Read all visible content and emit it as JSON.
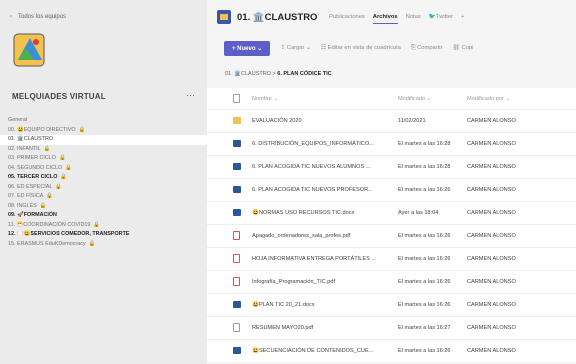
{
  "sidebar": {
    "back_label": "Todos los equipos",
    "team_name": "MELQUIADES VIRTUAL",
    "more": "···",
    "channels": [
      {
        "label": "General",
        "bold": false,
        "selected": false
      },
      {
        "label": "00. 😃EQUIPO DIRECTIVO",
        "bold": false,
        "selected": false,
        "pin": "🔒"
      },
      {
        "label": "01. 🏛️CLAUSTRO",
        "bold": false,
        "selected": true
      },
      {
        "label": "02. INFANTIL",
        "bold": false,
        "selected": false,
        "pin": "🔒"
      },
      {
        "label": "03. PRIMER CICLO",
        "bold": false,
        "selected": false,
        "pin": "🔒"
      },
      {
        "label": "04. SEGUNDO CICLO",
        "bold": false,
        "selected": false,
        "pin": "🔒"
      },
      {
        "label": "05. TERCER CICLO",
        "bold": true,
        "selected": false,
        "pin": "🔒"
      },
      {
        "label": "06. ED ESPECIAL",
        "bold": false,
        "selected": false,
        "pin": "🔒"
      },
      {
        "label": "07. ED FÍSICA",
        "bold": false,
        "selected": false,
        "pin": "🔒"
      },
      {
        "label": "08. INGLÉS",
        "bold": false,
        "selected": false,
        "pin": "🔒"
      },
      {
        "label": "09. 🚀FORMACIÓN",
        "bold": true,
        "selected": false
      },
      {
        "label": "11. 😷COORDINACIÓN COVID19",
        "bold": false,
        "selected": false,
        "pin": "🔒"
      },
      {
        "label": "12. 🍽️😃SERVICIOS COMEDOR, TRANSPORTE",
        "bold": true,
        "selected": false
      },
      {
        "label": "15. ERASMUS EduKDemocracy",
        "bold": false,
        "selected": false,
        "pin": "🔒"
      }
    ]
  },
  "header": {
    "title": "01. 🏛️CLAUSTRO",
    "tabs": [
      {
        "label": "Publicaciones",
        "active": false
      },
      {
        "label": "Archivos",
        "active": true
      },
      {
        "label": "Notas",
        "active": false
      },
      {
        "label": "🐦Twitter",
        "active": false
      },
      {
        "label": "+",
        "active": false
      }
    ]
  },
  "toolbar": {
    "new_label": "+ Nuevo ⌄",
    "items": [
      "⇪ Cargar ⌄",
      "☷ Editar en vista de cuadrícula",
      "⎘ Compartir",
      "⛓ Copi"
    ]
  },
  "breadcrumb": {
    "parent": "01. 🏛️CLAUSTRO",
    "sep": ">",
    "current": "6. PLAN CÓDICE TIC"
  },
  "list": {
    "columns": {
      "name": "Nombre ⌄",
      "modified": "Modificado ⌄",
      "modified_by": "Modificado por ⌄"
    },
    "rows": [
      {
        "type": "folder",
        "name": "EVALUACIÓN 2020",
        "modified": "11/02/2021",
        "by": "CARMEN ALONSO"
      },
      {
        "type": "word",
        "name": "6. DISTRIBUCIÓN_EQUIPOS_INFORMÁTICO...",
        "modified": "El martes a las 16:28",
        "by": "CARMEN ALONSO"
      },
      {
        "type": "word",
        "name": "6. PLAN ACOGIDA TIC NUEVOS ALUMNOS ...",
        "modified": "El martes a las 16:28",
        "by": "CARMEN ALONSO"
      },
      {
        "type": "word",
        "name": "6. PLAN ACOGIDA TIC NUEVOS PROFESOR...",
        "modified": "El martes a las 16:26",
        "by": "CARMEN ALONSO"
      },
      {
        "type": "word",
        "name": "😃NORMAS USO RECURSOS TIC.docx",
        "modified": "Ayer a las 18:04",
        "by": "CARMEN ALONSO"
      },
      {
        "type": "pdf",
        "name": "Apagado_ordenadores_sala_profes.pdf",
        "modified": "El martes a las 16:26",
        "by": "CARMEN ALONSO"
      },
      {
        "type": "pdf",
        "name": "HOJA INFORMATIVA ENTREGA PORTÁTILES ...",
        "modified": "El martes a las 16:26",
        "by": "CARMEN ALONSO"
      },
      {
        "type": "pdf",
        "name": "Infografía_Programación_TIC.pdf",
        "modified": "El martes a las 16:26",
        "by": "CARMEN ALONSO"
      },
      {
        "type": "word",
        "name": "😃PLAN TIC 20_21.docx",
        "modified": "El martes a las 16:26",
        "by": "CARMEN ALONSO"
      },
      {
        "type": "blank",
        "name": "RESUMEN MAYO20.pdf",
        "modified": "El martes a las 16:27",
        "by": "CARMEN ALONSO"
      },
      {
        "type": "word",
        "name": "😃SECUENCIACIÓN DE CONTENIDOS_CUE...",
        "modified": "El martes a las 16:26",
        "by": "CARMEN ALONSO"
      }
    ]
  }
}
